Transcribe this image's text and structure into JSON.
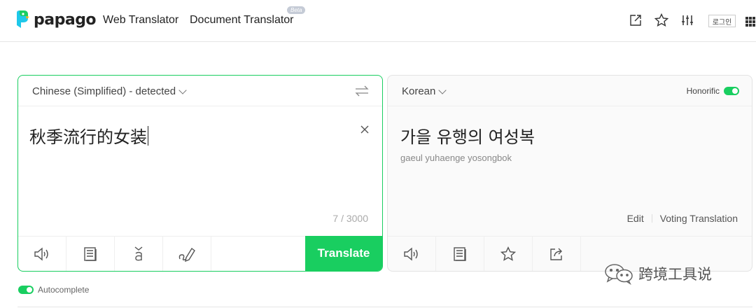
{
  "header": {
    "logo_text": "papago",
    "nav": {
      "web_translator": "Web Translator",
      "document_translator": "Document Translator",
      "beta_badge": "Beta"
    },
    "icons": [
      "new-window-icon",
      "star-icon",
      "equalizer-icon",
      "apps-grid-icon"
    ],
    "login_label": "로그인"
  },
  "source": {
    "language": "Chinese (Simplified) - detected",
    "text": "秋季流行的女装",
    "counter": "7 / 3000",
    "tools": [
      "speaker-icon",
      "dictionary-icon",
      "pinyin-icon",
      "handwriting-icon"
    ],
    "translate_label": "Translate"
  },
  "target": {
    "language": "Korean",
    "honorific_label": "Honorific",
    "honorific_on": true,
    "text": "가을 유행의 여성복",
    "romanization": "gaeul yuhaenge yosongbok",
    "edit_label": "Edit",
    "voting_label": "Voting Translation",
    "tools": [
      "speaker-icon",
      "dictionary-icon",
      "star-icon",
      "share-icon"
    ]
  },
  "autocomplete": {
    "label": "Autocomplete",
    "on": true
  },
  "watermark": {
    "text": "跨境工具说"
  },
  "colors": {
    "accent": "#19ce60",
    "border": "#e3e3e3"
  }
}
